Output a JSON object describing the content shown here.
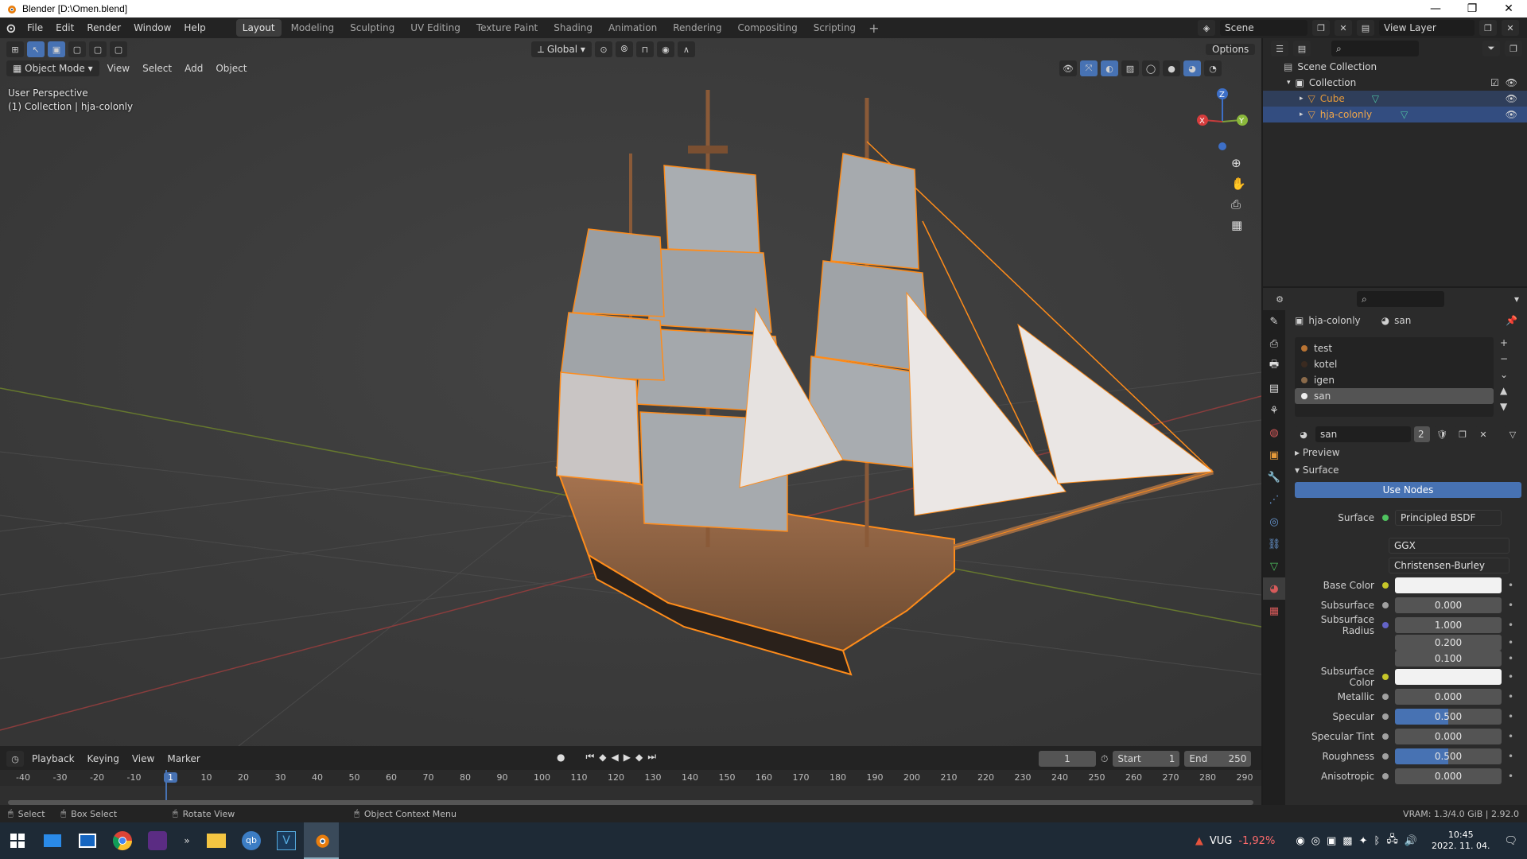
{
  "window": {
    "title": "Blender [D:\\Omen.blend]",
    "controls": [
      "—",
      "❐",
      "✕"
    ]
  },
  "menu": [
    "File",
    "Edit",
    "Render",
    "Window",
    "Help"
  ],
  "workspaces": [
    "Layout",
    "Modeling",
    "Sculpting",
    "UV Editing",
    "Texture Paint",
    "Shading",
    "Animation",
    "Rendering",
    "Compositing",
    "Scripting"
  ],
  "active_workspace": "Layout",
  "scene": "Scene",
  "view_layer": "View Layer",
  "viewport": {
    "transform_orientation": "Global",
    "options_label": "Options",
    "mode": "Object Mode",
    "header_menus": [
      "View",
      "Select",
      "Add",
      "Object"
    ],
    "overlay_line1": "User Perspective",
    "overlay_line2": "(1) Collection | hja-colonly",
    "axes": {
      "x": "X",
      "y": "Y",
      "z": "Z"
    }
  },
  "outliner": {
    "root": "Scene Collection",
    "collection": "Collection",
    "objects": [
      {
        "name": "Cube",
        "color": "#e69a3a"
      },
      {
        "name": "hja-colonly",
        "color": "#f0a64a"
      }
    ]
  },
  "properties": {
    "object_name": "hja-colonly",
    "material_name": "san",
    "material_slots": [
      "test",
      "kotel",
      "igen",
      "san"
    ],
    "material_field": "san",
    "user_count": "2",
    "panels": {
      "preview": "Preview",
      "surface": "Surface"
    },
    "use_nodes": "Use Nodes",
    "surface_label": "Surface",
    "surface_shader": "Principled BSDF",
    "distribution": "GGX",
    "subsurface_method": "Christensen-Burley",
    "rows": [
      {
        "label": "Base Color",
        "type": "color",
        "value": "",
        "dot": "#c7c729"
      },
      {
        "label": "Subsurface",
        "type": "num",
        "value": "0.000",
        "dot": "#a1a1a1"
      },
      {
        "label": "Subsurface Radius",
        "type": "num",
        "value": "1.000",
        "dot": "#6363c7"
      }
    ],
    "subsurface_radius_extra": [
      "0.200",
      "0.100"
    ],
    "rows2": [
      {
        "label": "Subsurface Color",
        "type": "color",
        "value": "",
        "dot": "#c7c729"
      },
      {
        "label": "Metallic",
        "type": "num",
        "value": "0.000",
        "dot": "#a1a1a1"
      },
      {
        "label": "Specular",
        "type": "num-blue",
        "value": "0.500",
        "dot": "#a1a1a1"
      },
      {
        "label": "Specular Tint",
        "type": "num",
        "value": "0.000",
        "dot": "#a1a1a1"
      },
      {
        "label": "Roughness",
        "type": "num-blue",
        "value": "0.500",
        "dot": "#a1a1a1"
      },
      {
        "label": "Anisotropic",
        "type": "num",
        "value": "0.000",
        "dot": "#a1a1a1"
      }
    ]
  },
  "timeline": {
    "menus": [
      "Playback",
      "Keying",
      "View",
      "Marker"
    ],
    "current_frame": "1",
    "start_label": "Start",
    "start": "1",
    "end_label": "End",
    "end": "250",
    "ruler": [
      "-40",
      "-30",
      "-20",
      "-10",
      "1",
      "10",
      "20",
      "30",
      "40",
      "50",
      "60",
      "70",
      "80",
      "90",
      "100",
      "110",
      "120",
      "130",
      "140",
      "150",
      "160",
      "170",
      "180",
      "190",
      "200",
      "210",
      "220",
      "230",
      "240",
      "250",
      "260",
      "270",
      "280",
      "290"
    ]
  },
  "status_bar": {
    "select": "Select",
    "box_select": "Box Select",
    "rotate_view": "Rotate View",
    "context_menu": "Object Context Menu",
    "vram": "VRAM: 1.3/4.0 GiB | 2.92.0"
  },
  "taskbar": {
    "stock_name": "VUG",
    "stock_change": "-1,92%",
    "time": "10:45",
    "date": "2022. 11. 04."
  },
  "colors": {
    "selection_outline": "#ff8c1a",
    "header_blue": "#4772b3",
    "outliner_selected": "#334d80"
  }
}
